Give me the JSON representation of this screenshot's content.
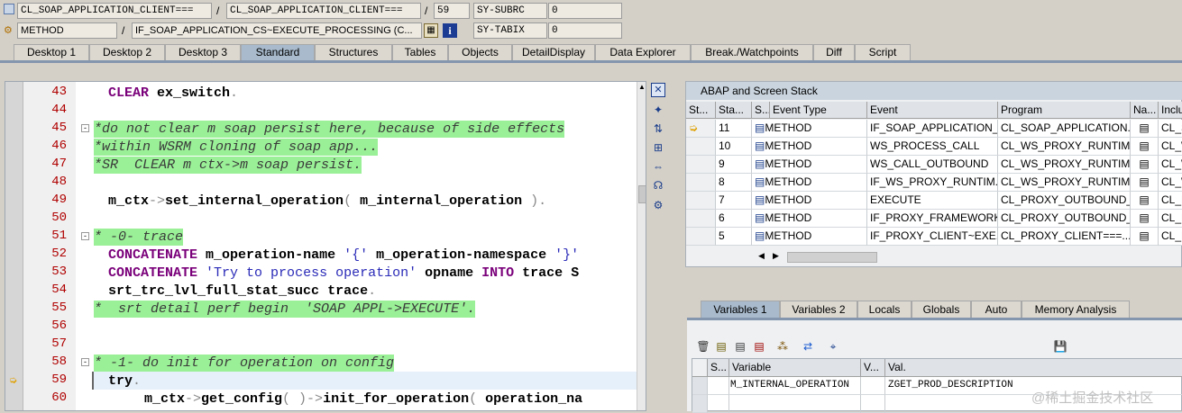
{
  "header": {
    "row1": {
      "field1": "CL_SOAP_APPLICATION_CLIENT===",
      "sep1": "/",
      "field2": "CL_SOAP_APPLICATION_CLIENT===",
      "sep2": "/",
      "line": "59",
      "sysvar": "SY-SUBRC",
      "sysval": "0"
    },
    "row2": {
      "field1": "METHOD",
      "sep1": "/",
      "field2": "IF_SOAP_APPLICATION_CS~EXECUTE_PROCESSING (C...",
      "sysvar": "SY-TABIX",
      "sysval": "0"
    }
  },
  "tabs": [
    "Desktop 1",
    "Desktop 2",
    "Desktop 3",
    "Standard",
    "Structures",
    "Tables",
    "Objects",
    "DetailDisplay",
    "Data Explorer",
    "Break./Watchpoints",
    "Diff",
    "Script"
  ],
  "selected_tab": "Standard",
  "editor": {
    "lines": [
      {
        "n": "43"
      },
      {
        "n": "44"
      },
      {
        "n": "45"
      },
      {
        "n": "46"
      },
      {
        "n": "47"
      },
      {
        "n": "48"
      },
      {
        "n": "49"
      },
      {
        "n": "50"
      },
      {
        "n": "51"
      },
      {
        "n": "52"
      },
      {
        "n": "53"
      },
      {
        "n": "54"
      },
      {
        "n": "55"
      },
      {
        "n": "56"
      },
      {
        "n": "57"
      },
      {
        "n": "58"
      },
      {
        "n": "59"
      },
      {
        "n": "60"
      }
    ],
    "code": {
      "l43": {
        "kw": "CLEAR",
        "rest": "ex_switch",
        "end": "."
      },
      "l45": "*do not clear m soap persist here, because of side effects",
      "l46": "*within WSRM cloning of soap app...",
      "l47": "*SR  CLEAR m ctx->m soap persist.",
      "l49": {
        "a": "m_ctx",
        "b": "->",
        "c": "set_internal_operation",
        "d": "( ",
        "e": "m_internal_operation",
        "f": " ).",
        "g": ""
      },
      "l51": "* -0- trace",
      "l52": {
        "kw": "CONCATENATE",
        "a": "m_operation-name",
        "b": "'{'",
        "c": "m_operation-namespace",
        "d": "'}'"
      },
      "l53": {
        "kw": "CONCATENATE",
        "a": "'Try to process operation'",
        "b": "opname",
        "c": "INTO",
        "d": "trace",
        "e": "S"
      },
      "l54": {
        "a": "srt_trc_lvl_full_stat_succ",
        "b": "trace",
        "c": "."
      },
      "l55": "*  srt detail perf begin  'SOAP APPL->EXECUTE'.",
      "l58": "* -1- do init for operation on config",
      "l59": {
        "kw": "try",
        "end": "."
      },
      "l60": {
        "a": "m_ctx",
        "b": "->",
        "c": "get_config",
        "d": "( )->",
        "e": "init_for_operation",
        "f": "( ",
        "g": "operation_na"
      }
    },
    "current_line": "59"
  },
  "stack": {
    "title": "ABAP and Screen Stack",
    "columns": [
      "St...",
      "Sta...",
      "S...",
      "Event Type",
      "Event",
      "Program",
      "Na...",
      "Inclu"
    ],
    "rows": [
      {
        "level": "11",
        "type": "METHOD",
        "event": "IF_SOAP_APPLICATION_...",
        "program": "CL_SOAP_APPLICATION...",
        "incl": "CL_S",
        "current": true
      },
      {
        "level": "10",
        "type": "METHOD",
        "event": "WS_PROCESS_CALL",
        "program": "CL_WS_PROXY_RUNTIM...",
        "incl": "CL_W"
      },
      {
        "level": "9",
        "type": "METHOD",
        "event": "WS_CALL_OUTBOUND",
        "program": "CL_WS_PROXY_RUNTIM...",
        "incl": "CL_W"
      },
      {
        "level": "8",
        "type": "METHOD",
        "event": "IF_WS_PROXY_RUNTIM...",
        "program": "CL_WS_PROXY_RUNTIM...",
        "incl": "CL_W"
      },
      {
        "level": "7",
        "type": "METHOD",
        "event": "EXECUTE",
        "program": "CL_PROXY_OUTBOUND_...",
        "incl": "CL_P"
      },
      {
        "level": "6",
        "type": "METHOD",
        "event": "IF_PROXY_FRAMEWORK...",
        "program": "CL_PROXY_OUTBOUND_...",
        "incl": "CL_P"
      },
      {
        "level": "5",
        "type": "METHOD",
        "event": "IF_PROXY_CLIENT~EXE...",
        "program": "CL_PROXY_CLIENT===...",
        "incl": "CL_P"
      }
    ]
  },
  "vartabs": [
    "Variables 1",
    "Variables 2",
    "Locals",
    "Globals",
    "Auto",
    "Memory Analysis"
  ],
  "vartab_selected": "Variables 1",
  "vars": {
    "columns": [
      "S...",
      "Variable",
      "V...",
      "Val."
    ],
    "rows": [
      {
        "variable": "M_INTERNAL_OPERATION",
        "value": "ZGET_PROD_DESCRIPTION"
      }
    ]
  },
  "watermark": "@稀土掘金技术社区"
}
